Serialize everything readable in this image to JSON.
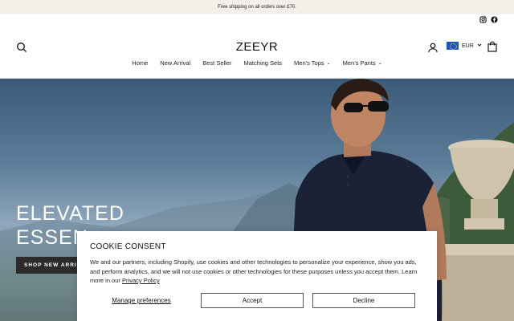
{
  "announcement": {
    "text": "Free shipping on all orders over £70."
  },
  "social": {
    "icons": [
      "instagram-icon",
      "facebook-icon"
    ]
  },
  "header": {
    "logo": "ZEEYR",
    "currency": "EUR"
  },
  "nav": {
    "items": [
      {
        "label": "Home",
        "has_dropdown": false
      },
      {
        "label": "New Arrival",
        "has_dropdown": false
      },
      {
        "label": "Best Seller",
        "has_dropdown": false
      },
      {
        "label": "Matching Sets",
        "has_dropdown": false
      },
      {
        "label": "Men's Tops",
        "has_dropdown": true
      },
      {
        "label": "Men's Pants",
        "has_dropdown": true
      }
    ],
    "dropdown_glyph": "⌄"
  },
  "hero": {
    "title_line1": "ELEVATED",
    "title_line2": "ESSEN",
    "button_label": "SHOP NEW ARRI"
  },
  "cookie": {
    "title": "COOKIE CONSENT",
    "body": "We and our partners, including Shopify, use cookies and other technologies to personalize your experience, show you ads, and perform analytics, and we will not use cookies or other technologies for these purposes unless you accept them. Learn more in our ",
    "policy_link": "Privacy Policy",
    "manage_label": "Manage preferences",
    "accept_label": "Accept",
    "decline_label": "Decline"
  },
  "colors": {
    "announcement_bg": "#f3efe9",
    "button_dark": "#2b2b2b",
    "shirt_navy": "#1b2236"
  }
}
